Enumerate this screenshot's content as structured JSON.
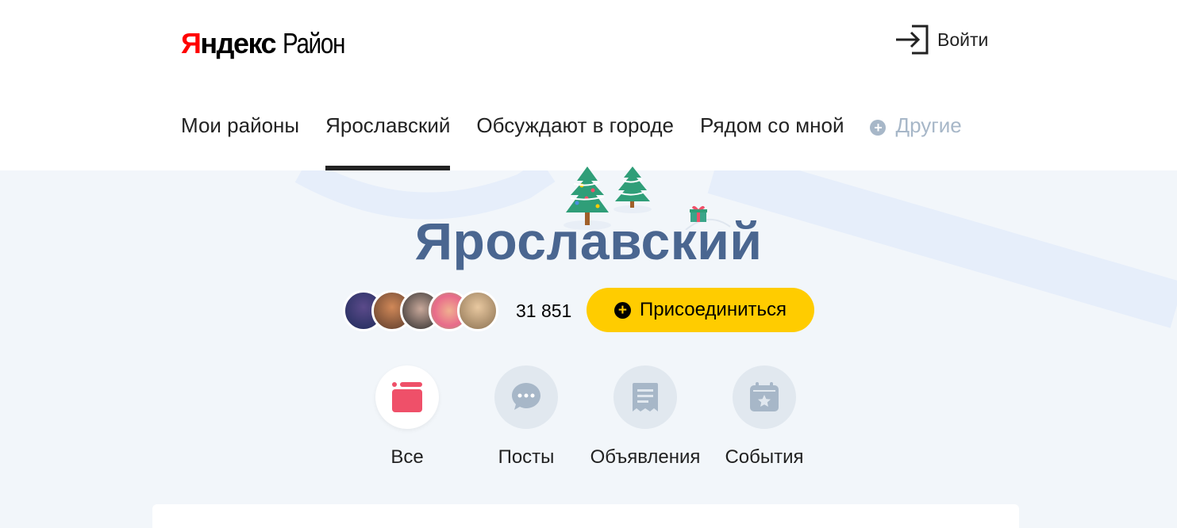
{
  "header": {
    "logo": {
      "part1": "Я",
      "part2": "ндекс",
      "product": "Район"
    },
    "login_label": "Войти"
  },
  "nav": {
    "items": [
      {
        "label": "Мои районы"
      },
      {
        "label": "Ярославский",
        "active": true
      },
      {
        "label": "Обсуждают в городе"
      },
      {
        "label": "Рядом со мной"
      }
    ],
    "other_label": "Другие"
  },
  "district": {
    "title": "Ярославский",
    "member_count": "31 851",
    "join_label": "Присоединиться"
  },
  "categories": [
    {
      "label": "Все",
      "icon": "feed-icon",
      "active": true
    },
    {
      "label": "Посты",
      "icon": "chat-bubble-icon"
    },
    {
      "label": "Объявления",
      "icon": "receipt-icon"
    },
    {
      "label": "События",
      "icon": "calendar-star-icon"
    }
  ],
  "colors": {
    "accent": "#ffcc00",
    "title": "#4a6690",
    "active_category": "#ef5069",
    "inactive_icon": "#a7b7c8",
    "background": "#f2f6fa"
  }
}
